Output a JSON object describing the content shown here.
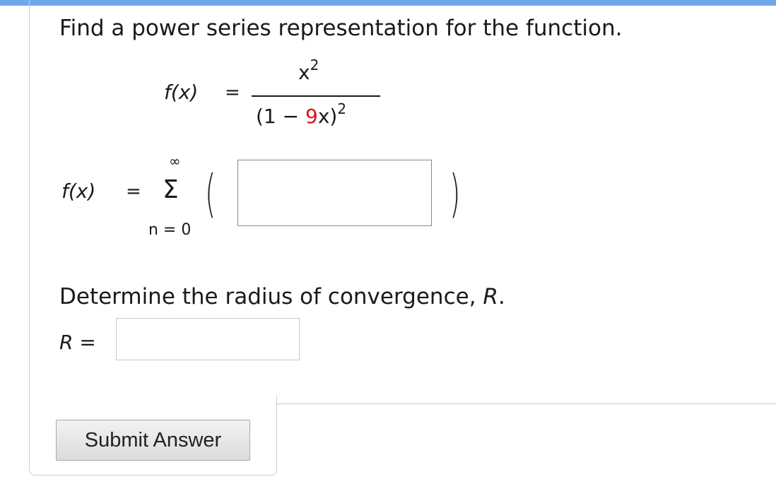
{
  "question": {
    "prompt": "Find a power series representation for the function.",
    "function": {
      "lhs": "f(x)",
      "equals": "=",
      "numerator_base": "x",
      "numerator_exp": "2",
      "denominator_open": "(1 − ",
      "denominator_coef": "9",
      "denominator_var": "x)",
      "denominator_exp": "2",
      "highlight_color": "#dd1111"
    },
    "series": {
      "lhs": "f(x)",
      "equals": "=",
      "upper_limit": "∞",
      "sigma": "Σ",
      "lower_limit": "n = 0",
      "open_paren": "(",
      "close_paren": ")",
      "term_value": ""
    },
    "radius": {
      "prompt_text": "Determine the radius of convergence, ",
      "prompt_var": "R",
      "prompt_end": ".",
      "label": "R",
      "equals": "=",
      "value": ""
    }
  },
  "actions": {
    "submit_label": "Submit Answer"
  },
  "colors": {
    "top_bar": "#6fa8ef",
    "frame": "#cfcfcf"
  }
}
